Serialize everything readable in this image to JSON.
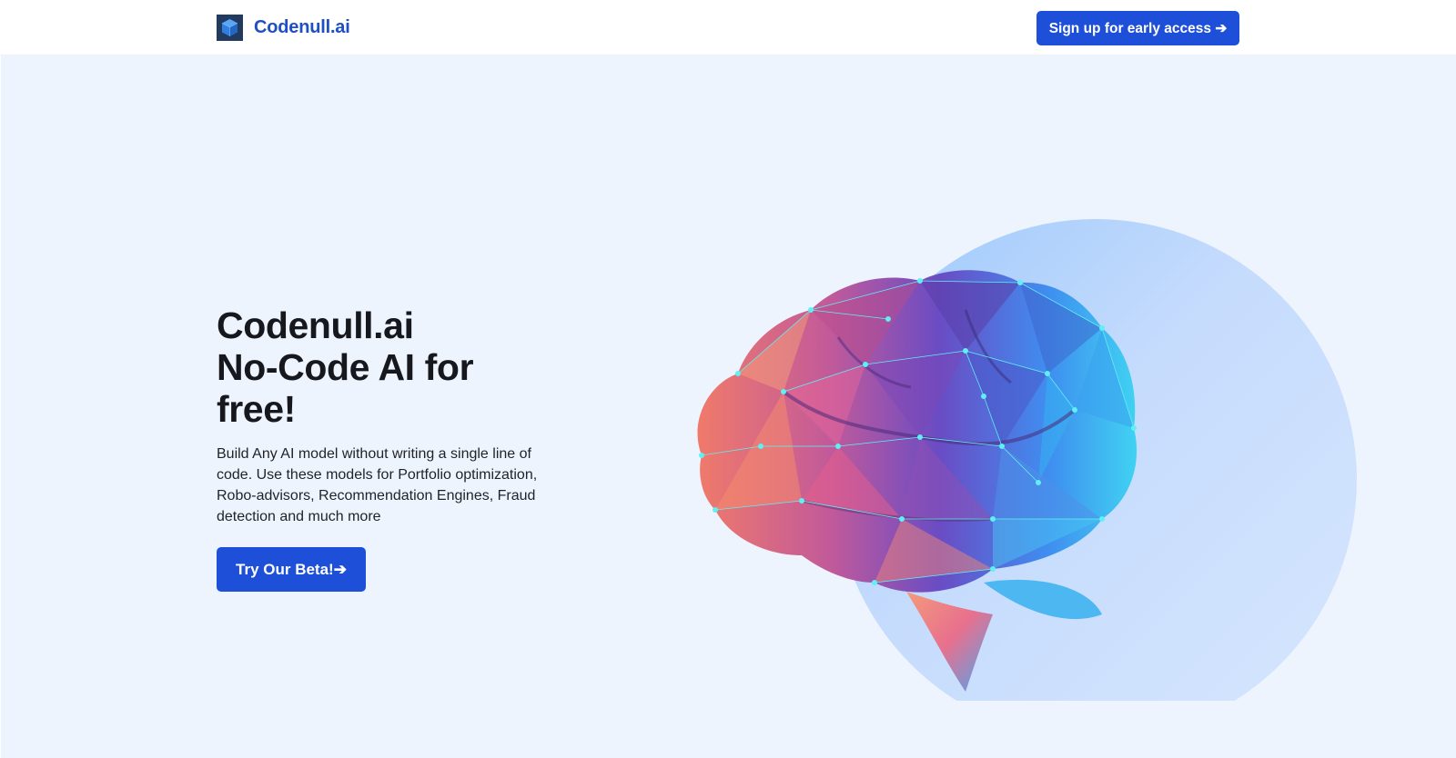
{
  "header": {
    "brand_name": "Codenull.ai",
    "logo_icon": "cube-logo-icon",
    "signup_label": "Sign up for early access ➔"
  },
  "hero": {
    "title_line1": "Codenull.ai",
    "title_line2": "No-Code AI for",
    "title_line3": "free!",
    "description": "Build Any AI model without writing a single line of code. Use these models for Portfolio optimization, Robo-advisors, Recommendation Engines, Fraud detection and much more",
    "cta_label": "Try Our Beta!➔",
    "illustration": "low-poly-brain-icon"
  },
  "colors": {
    "accent": "#1d4fd8",
    "brand_text": "#1f4fc4",
    "hero_background": "#eef4fe",
    "circle": "#c9defc"
  }
}
